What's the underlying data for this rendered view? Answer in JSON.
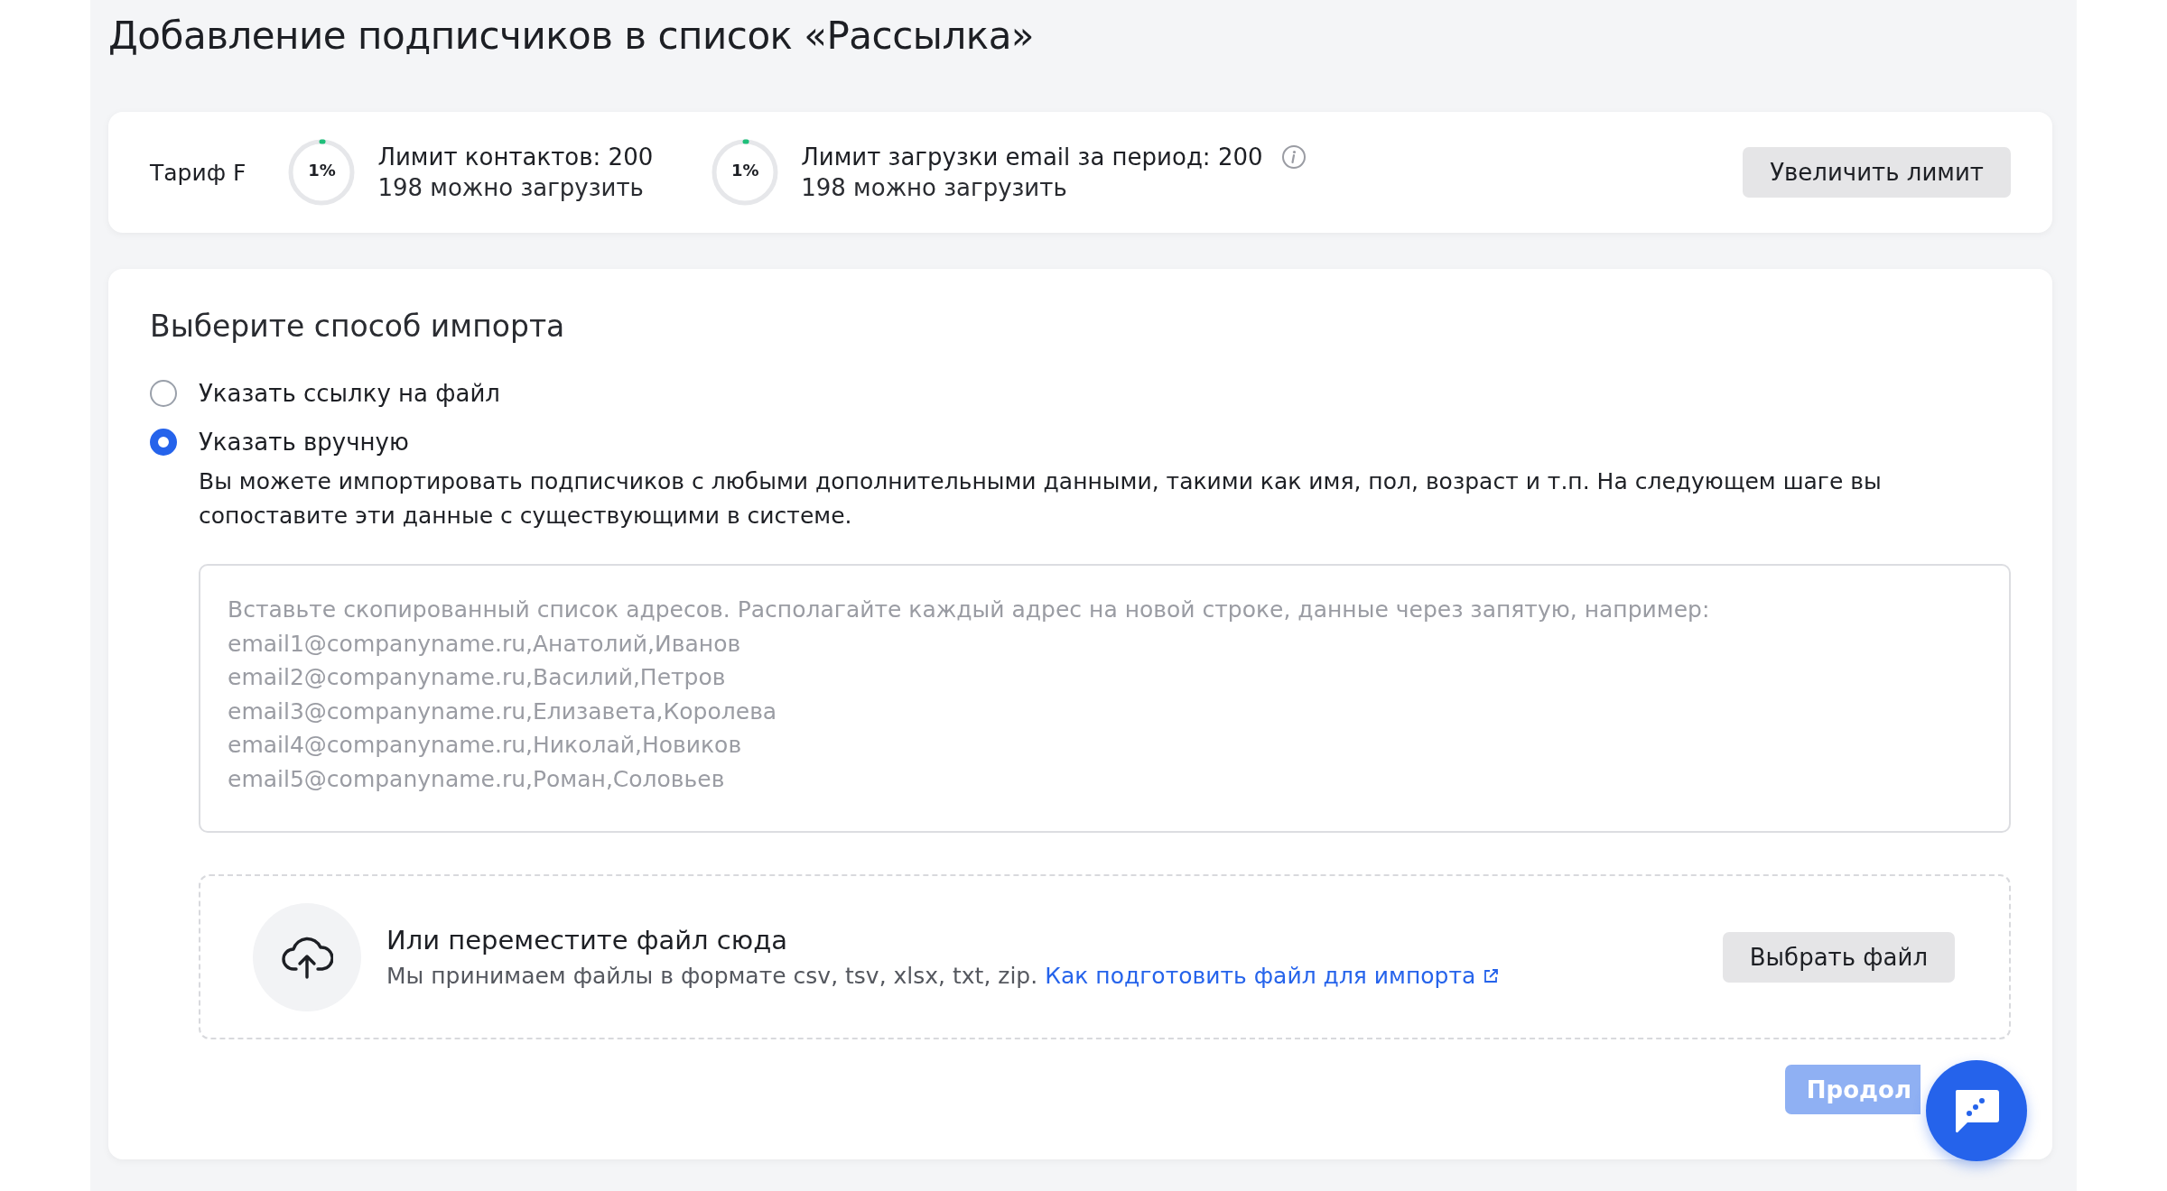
{
  "title": "Добавление подписчиков в список «Рассылка»",
  "limits": {
    "plan": "Тариф F",
    "items": [
      {
        "percent": "1%",
        "level": 0.01,
        "label": "Лимит контактов: 200",
        "sub": "198 можно загрузить",
        "info": false
      },
      {
        "percent": "1%",
        "level": 0.01,
        "label": "Лимит загрузки email за период: 200",
        "sub": "198 можно загрузить",
        "info": true
      }
    ],
    "button": "Увеличить лимит"
  },
  "import": {
    "heading": "Выберите способ импорта",
    "options": [
      {
        "label": "Указать ссылку на файл",
        "selected": false
      },
      {
        "label": "Указать вручную",
        "selected": true,
        "description": "Вы можете импортировать подписчиков с любыми дополнительными данными, такими как имя, пол, возраст и т.п. На следующем шаге вы сопоставите эти данные с существующими в системе."
      }
    ],
    "textarea": {
      "placeholder": "Вставьте скопированный список адресов. Располагайте каждый адрес на новой строке, данные через запятую, например:\nemail1@companyname.ru,Анатолий,Иванов\nemail2@companyname.ru,Василий,Петров\nemail3@companyname.ru,Елизавета,Королева\nemail4@companyname.ru,Николай,Новиков\nemail5@companyname.ru,Роман,Соловьев"
    },
    "dropzone": {
      "title": "Или переместите файл сюда",
      "text": "Мы принимаем файлы в формате csv, tsv, xlsx, txt, zip.",
      "link": "Как подготовить файл для импорта",
      "button": "Выбрать файл"
    },
    "continue": {
      "label": "Продол",
      "disabled": true
    }
  }
}
